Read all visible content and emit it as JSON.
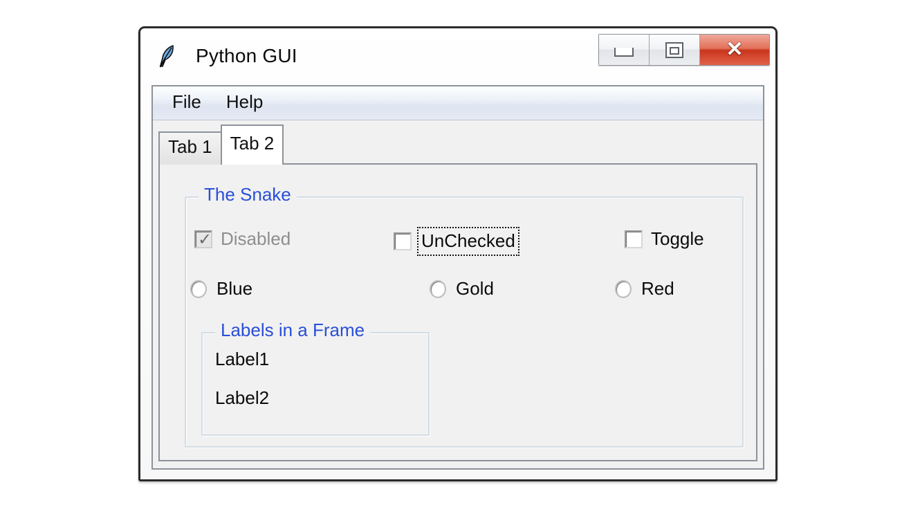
{
  "window": {
    "title": "Python GUI",
    "icon": "feather-icon",
    "buttons": {
      "minimize": "minimize-icon",
      "maximize": "maximize-icon",
      "close": "✕"
    },
    "close_color": "#c9351c"
  },
  "menubar": {
    "items": [
      {
        "label": "File"
      },
      {
        "label": "Help"
      }
    ]
  },
  "notebook": {
    "tabs": [
      {
        "label": "Tab 1",
        "active": false
      },
      {
        "label": "Tab 2",
        "active": true
      }
    ]
  },
  "snake_group": {
    "title": "The Snake",
    "title_color": "#2a4fd8",
    "checkboxes": [
      {
        "label": "Disabled",
        "checked": true,
        "disabled": true,
        "focused": false
      },
      {
        "label": "UnChecked",
        "checked": false,
        "disabled": false,
        "focused": true
      },
      {
        "label": "Toggle",
        "checked": false,
        "disabled": false,
        "focused": false
      }
    ],
    "radios": [
      {
        "label": "Blue",
        "selected": false
      },
      {
        "label": "Gold",
        "selected": false
      },
      {
        "label": "Red",
        "selected": false
      }
    ]
  },
  "labels_group": {
    "title": "Labels in a Frame",
    "title_color": "#2a4fd8",
    "labels": [
      {
        "text": "Label1"
      },
      {
        "text": "Label2"
      }
    ]
  }
}
